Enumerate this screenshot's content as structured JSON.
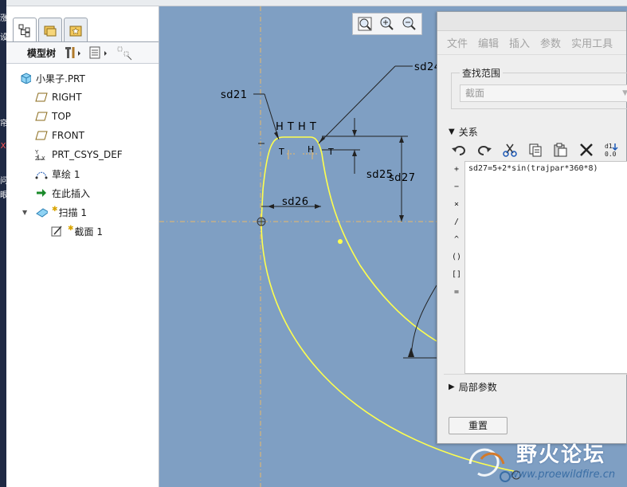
{
  "edge_strip": {
    "glyphs": [
      "涨",
      "设",
      "帘",
      "X",
      "问",
      "眼"
    ]
  },
  "tree": {
    "title": "模型树",
    "items": [
      {
        "label": "小果子.PRT",
        "icon": "part-icon",
        "indent": 0
      },
      {
        "label": "RIGHT",
        "icon": "datum-plane-icon",
        "indent": 1
      },
      {
        "label": "TOP",
        "icon": "datum-plane-icon",
        "indent": 1
      },
      {
        "label": "FRONT",
        "icon": "datum-plane-icon",
        "indent": 1
      },
      {
        "label": "PRT_CSYS_DEF",
        "icon": "csys-icon",
        "indent": 1
      },
      {
        "label": "草绘 1",
        "icon": "sketch-icon",
        "indent": 1
      },
      {
        "label": "在此插入",
        "icon": "insert-arrow-icon",
        "indent": 1
      },
      {
        "label": "扫描 1",
        "icon": "sweep-icon",
        "indent": 1,
        "expanded": true,
        "new": true
      },
      {
        "label": "截面 1",
        "icon": "section-icon",
        "indent": 2,
        "new": true
      }
    ]
  },
  "canvas": {
    "dims": {
      "sd21": "sd21",
      "sd24": "sd24",
      "sd25": "sd25",
      "sd26": "sd26",
      "sd27": "sd27",
      "htht": "H T H T",
      "t1": "T",
      "t2": "T",
      "h": "H"
    },
    "colors": {
      "background": "#7f9fc3",
      "curve": "#ffff4d",
      "axis": "#e8b96a"
    }
  },
  "zoom": {
    "buttons": [
      "zoom-fit-icon",
      "zoom-in-icon",
      "zoom-out-icon"
    ]
  },
  "dialog": {
    "menu": [
      "文件",
      "编辑",
      "插入",
      "参数",
      "实用工具"
    ],
    "scope_label": "查找范围",
    "scope_value": "截面",
    "relations_label": "关系",
    "ops": [
      "+",
      "−",
      "×",
      "/",
      "^",
      "()",
      "[]",
      "="
    ],
    "relation_text": "sd27=5+2*sin(trajpar*360*8)",
    "local_params_label": "局部参数",
    "reset_label": "重置"
  },
  "watermark": {
    "title": "野火论坛",
    "url": "www.proewildfire.cn"
  }
}
